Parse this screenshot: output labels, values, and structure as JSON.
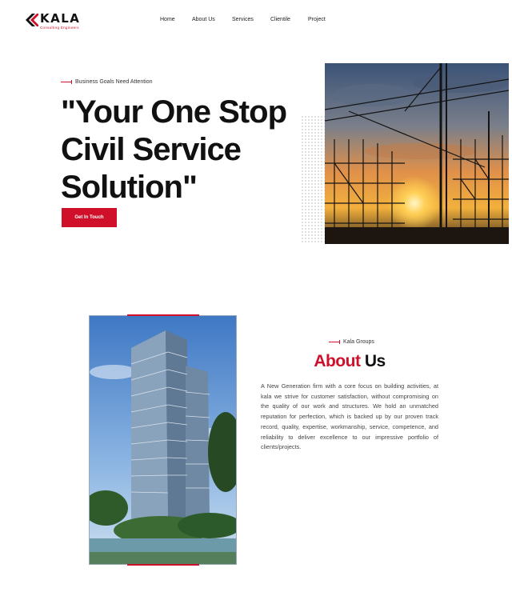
{
  "header": {
    "logo_name": "KALA",
    "logo_tagline": "Consulting Engineers",
    "nav": [
      "Home",
      "About Us",
      "Services",
      "Clientile",
      "Project"
    ]
  },
  "hero": {
    "kicker": "Business Goals Need Attention",
    "title": "\"Your One Stop Civil Service Solution\"",
    "cta_label": "Get In Touch",
    "image_alt": "Construction scaffolding and cranes at sunset"
  },
  "about": {
    "kicker": "Kala Groups",
    "title_red": "About",
    "title_dark": "Us",
    "body": "A New Generation firm with a core focus on building activities, at kala we strive for customer satisfaction, without compromising on the quality of our work and structures. We hold an unmatched reputation for perfection, which is backed up by our proven track record, quality, expertise, workmanship, service, competence, and reliability to deliver excellence to our impressive portfolio of clients/projects.",
    "image_alt": "High-rise residential tower"
  },
  "colors": {
    "accent": "#d0102a",
    "text": "#111111"
  }
}
